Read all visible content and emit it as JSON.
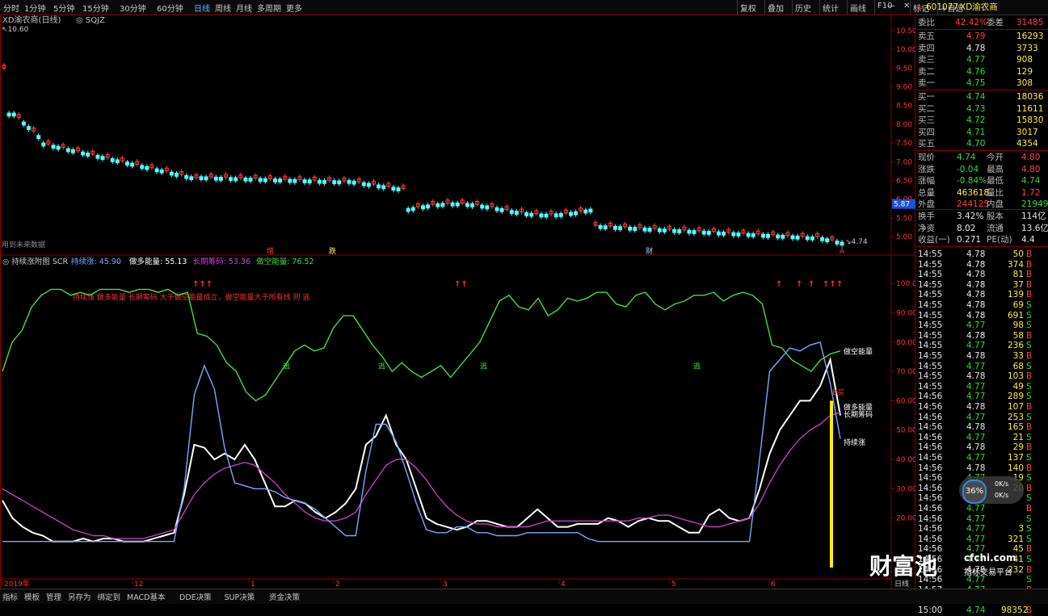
{
  "toolbar": {
    "tabs": [
      "分时",
      "1分钟",
      "5分钟",
      "15分钟",
      "30分钟",
      "60分钟",
      "日线",
      "周线",
      "月线",
      "多周期",
      "更多"
    ],
    "active_tab": "日线",
    "right_buttons": [
      "复权",
      "叠加",
      "历史",
      "统计",
      "画线",
      "F10",
      "标记",
      "+自选"
    ]
  },
  "price_panel": {
    "title": "XD渝农商(日线)",
    "indicator": "SQJZ",
    "high_marker": "10.60",
    "last_marker": "4.74",
    "price_tag": "5.87",
    "future_label": "用到未来数据",
    "axis_ticks": [
      "10.50",
      "10.00",
      "9.50",
      "9.00",
      "8.50",
      "8.00",
      "7.50",
      "7.00",
      "6.50",
      "6.00",
      "5.50",
      "5.00"
    ],
    "tags": [
      {
        "text": "增"
      },
      {
        "text": "跌"
      },
      {
        "text": "财"
      },
      {
        "text": "A"
      }
    ]
  },
  "indicator_panel": {
    "title": "持续涨附图",
    "scr": "SCR",
    "fields": [
      {
        "label": "持续涨:",
        "value": "45.90",
        "color": "#7aa8ff"
      },
      {
        "label": "做多能量:",
        "value": "55.13",
        "color": "#ffffff"
      },
      {
        "label": "长期筹码:",
        "value": "53.36",
        "color": "#d040d0"
      },
      {
        "label": "做空能量:",
        "value": "76.52",
        "color": "#44dd44"
      }
    ],
    "description": "持续涨 做多能量 长期筹码 大于做空能量成立，做空能量大于所有线 则 逃",
    "escape_label": "逃",
    "buy_label": "B买",
    "axis_ticks": [
      "100.00",
      "90.00",
      "80.00",
      "70.00",
      "60.00",
      "50.00",
      "40.00",
      "30.00",
      "20.00"
    ],
    "line_labels": {
      "short": "做空能量",
      "long_energy": "做多能量",
      "chips": "长期筹码",
      "rise": "持续涨"
    }
  },
  "chart_data": {
    "type": "line",
    "x_ticks": [
      "2019年",
      "12",
      "1",
      "2",
      "3",
      "4",
      "5",
      "6"
    ],
    "ylim": [
      10,
      105
    ],
    "series": [
      {
        "name": "做空能量",
        "color": "#44dd44",
        "values": [
          70,
          80,
          84,
          92,
          96,
          98,
          98,
          96,
          97,
          96,
          98,
          98,
          98,
          97,
          98,
          98,
          97,
          98,
          96,
          97,
          83,
          82,
          79,
          73,
          70,
          63,
          60,
          62,
          67,
          72,
          77,
          79,
          77,
          78,
          85,
          89,
          89,
          84,
          79,
          75,
          70,
          73,
          70,
          68,
          70,
          72,
          68,
          72,
          76,
          80,
          87,
          94,
          96,
          92,
          91,
          95,
          89,
          91,
          95,
          94,
          95,
          97,
          97,
          93,
          92,
          96,
          97,
          93,
          91,
          93,
          94,
          96,
          96,
          97,
          94,
          96,
          97,
          96,
          93,
          79,
          78,
          74,
          72,
          70,
          74,
          76,
          77
        ]
      },
      {
        "name": "做多能量",
        "color": "#ffffff",
        "values": [
          26,
          20,
          17,
          15,
          14,
          12,
          12,
          12,
          13,
          12,
          13,
          13,
          12,
          12,
          12,
          13,
          14,
          15,
          28,
          45,
          44,
          40,
          42,
          40,
          45,
          40,
          32,
          24,
          24,
          26,
          25,
          22,
          20,
          22,
          25,
          30,
          45,
          48,
          55,
          45,
          40,
          30,
          20,
          18,
          17,
          16,
          17,
          19,
          19,
          18,
          17,
          17,
          20,
          23,
          20,
          17,
          17,
          18,
          18,
          18,
          20,
          19,
          17,
          19,
          20,
          19,
          19,
          17,
          15,
          15,
          21,
          23,
          20,
          19,
          20,
          30,
          42,
          50,
          55,
          60,
          60,
          65,
          74,
          55
        ]
      },
      {
        "name": "长期筹码",
        "color": "#c040c0",
        "values": [
          30,
          28,
          26,
          24,
          22,
          20,
          18,
          16,
          15,
          14,
          14,
          13,
          13,
          13,
          13,
          14,
          15,
          16,
          22,
          28,
          32,
          35,
          37,
          38,
          39,
          38,
          35,
          32,
          28,
          25,
          22,
          20,
          19,
          19,
          20,
          22,
          28,
          33,
          38,
          40,
          40,
          37,
          33,
          28,
          24,
          21,
          19,
          18,
          18,
          17,
          17,
          17,
          17,
          18,
          19,
          19,
          19,
          19,
          19,
          19,
          19,
          19,
          19,
          20,
          20,
          21,
          21,
          20,
          19,
          18,
          17,
          17,
          18,
          19,
          20,
          25,
          32,
          38,
          43,
          47,
          50,
          52,
          55,
          56
        ]
      },
      {
        "name": "持续涨",
        "color": "#7aa8ff",
        "values": [
          12,
          12,
          12,
          12,
          12,
          12,
          12,
          12,
          12,
          12,
          12,
          12,
          12,
          12,
          12,
          12,
          12,
          12,
          30,
          62,
          72,
          64,
          44,
          32,
          31,
          30,
          30,
          29,
          27,
          26,
          25,
          23,
          20,
          17,
          14,
          14,
          36,
          52,
          52,
          46,
          36,
          25,
          16,
          15,
          15,
          17,
          17,
          15,
          15,
          14,
          14,
          14,
          15,
          15,
          15,
          15,
          15,
          15,
          13,
          12,
          12,
          12,
          12,
          12,
          12,
          12,
          12,
          12,
          12,
          12,
          12,
          12,
          12,
          12,
          12,
          40,
          70,
          74,
          78,
          77,
          79,
          80,
          66,
          47
        ]
      }
    ]
  },
  "quote": {
    "code": "601077",
    "name": "XD渝农商",
    "weibi_label": "委比",
    "weibi": "42.42%",
    "weicha_label": "委差",
    "weicha": "31485",
    "asks": [
      {
        "label": "卖五",
        "price": "4.79",
        "vol": "16293"
      },
      {
        "label": "卖四",
        "price": "4.78",
        "vol": "3733"
      },
      {
        "label": "卖三",
        "price": "4.77",
        "vol": "908"
      },
      {
        "label": "卖二",
        "price": "4.76",
        "vol": "129"
      },
      {
        "label": "卖一",
        "price": "4.75",
        "vol": "308"
      }
    ],
    "bids": [
      {
        "label": "买一",
        "price": "4.74",
        "vol": "18036"
      },
      {
        "label": "买二",
        "price": "4.73",
        "vol": "11611"
      },
      {
        "label": "买三",
        "price": "4.72",
        "vol": "15830"
      },
      {
        "label": "买四",
        "price": "4.71",
        "vol": "3017"
      },
      {
        "label": "买五",
        "price": "4.70",
        "vol": "4354"
      }
    ],
    "stats": [
      {
        "l1": "现价",
        "v1": "4.74",
        "c1": "green",
        "l2": "今开",
        "v2": "4.80",
        "c2": "red"
      },
      {
        "l1": "涨跌",
        "v1": "-0.04",
        "c1": "green",
        "l2": "最高",
        "v2": "4.80",
        "c2": "red"
      },
      {
        "l1": "涨幅",
        "v1": "-0.84%",
        "c1": "green",
        "l2": "最低",
        "v2": "4.74",
        "c2": "green"
      },
      {
        "l1": "总量",
        "v1": "463618",
        "c1": "yellow",
        "l2": "量比",
        "v2": "1.72",
        "c2": "red"
      },
      {
        "l1": "外盘",
        "v1": "244125",
        "c1": "red",
        "l2": "内盘",
        "v2": "219493",
        "c2": "green"
      },
      {
        "l1": "换手",
        "v1": "3.42%",
        "c1": "white",
        "l2": "股本",
        "v2": "114亿",
        "c2": "white"
      },
      {
        "l1": "净资",
        "v1": "8.02",
        "c1": "white",
        "l2": "流通",
        "v2": "13.6亿",
        "c2": "white"
      },
      {
        "l1": "收益(一)",
        "v1": "0.271",
        "c1": "white",
        "l2": "PE(动)",
        "v2": "4.4",
        "c2": "white"
      }
    ],
    "ticks": [
      [
        "14:55",
        "4.78",
        "50",
        "B"
      ],
      [
        "14:55",
        "4.78",
        "374",
        "B"
      ],
      [
        "14:55",
        "4.78",
        "81",
        "B"
      ],
      [
        "14:55",
        "4.78",
        "37",
        "B"
      ],
      [
        "14:55",
        "4.78",
        "139",
        "B"
      ],
      [
        "14:55",
        "4.78",
        "69",
        "S"
      ],
      [
        "14:55",
        "4.78",
        "691",
        "S"
      ],
      [
        "14:55",
        "4.77",
        "98",
        "S"
      ],
      [
        "14:55",
        "4.78",
        "58",
        "B"
      ],
      [
        "14:55",
        "4.77",
        "236",
        "S"
      ],
      [
        "14:55",
        "4.78",
        "33",
        "B"
      ],
      [
        "14:55",
        "4.77",
        "68",
        "S"
      ],
      [
        "14:55",
        "4.78",
        "103",
        "B"
      ],
      [
        "14:55",
        "4.77",
        "49",
        "S"
      ],
      [
        "14:56",
        "4.77",
        "289",
        "S"
      ],
      [
        "14:56",
        "4.78",
        "107",
        "B"
      ],
      [
        "14:56",
        "4.77",
        "253",
        "S"
      ],
      [
        "14:56",
        "4.78",
        "165",
        "B"
      ],
      [
        "14:56",
        "4.77",
        "21",
        "S"
      ],
      [
        "14:56",
        "4.78",
        "29",
        "B"
      ],
      [
        "14:56",
        "4.77",
        "137",
        "S"
      ],
      [
        "14:56",
        "4.78",
        "140",
        "B"
      ],
      [
        "14:56",
        "4.77",
        "19",
        "S"
      ],
      [
        "14:56",
        "4.78",
        "20",
        "B"
      ],
      [
        "14:56",
        "4.78",
        "",
        "S"
      ],
      [
        "14:56",
        "4.77",
        "",
        "B"
      ],
      [
        "14:56",
        "4.77",
        "",
        "S"
      ],
      [
        "14:56",
        "4.77",
        "3",
        "S"
      ],
      [
        "14:56",
        "4.77",
        "321",
        "S"
      ],
      [
        "14:56",
        "4.77",
        "45",
        "B"
      ],
      [
        "14:56",
        "4.77",
        "41",
        "S"
      ],
      [
        "14:56",
        "4.78",
        "232",
        "B"
      ],
      [
        "14:56",
        "4.77",
        "",
        "S"
      ],
      [
        "14:57",
        "4.77",
        "",
        "B"
      ],
      [
        "14:57",
        "4.77",
        "45",
        "S"
      ],
      [
        "15:00",
        "4.74",
        "98352",
        "B"
      ]
    ]
  },
  "bottom": {
    "tabs": [
      "指标",
      "模板",
      "管理",
      "另存为",
      "绑定到",
      "MACD基本",
      "DDE决策",
      "SUP决策",
      "资金决策"
    ],
    "period": "日线"
  },
  "speed": {
    "pct": "36%",
    "up": "0K/s",
    "down": "0K/s"
  },
  "watermark": {
    "big": "财富池",
    "site": "cfchi.com",
    "slogan": "指标交易平台"
  }
}
